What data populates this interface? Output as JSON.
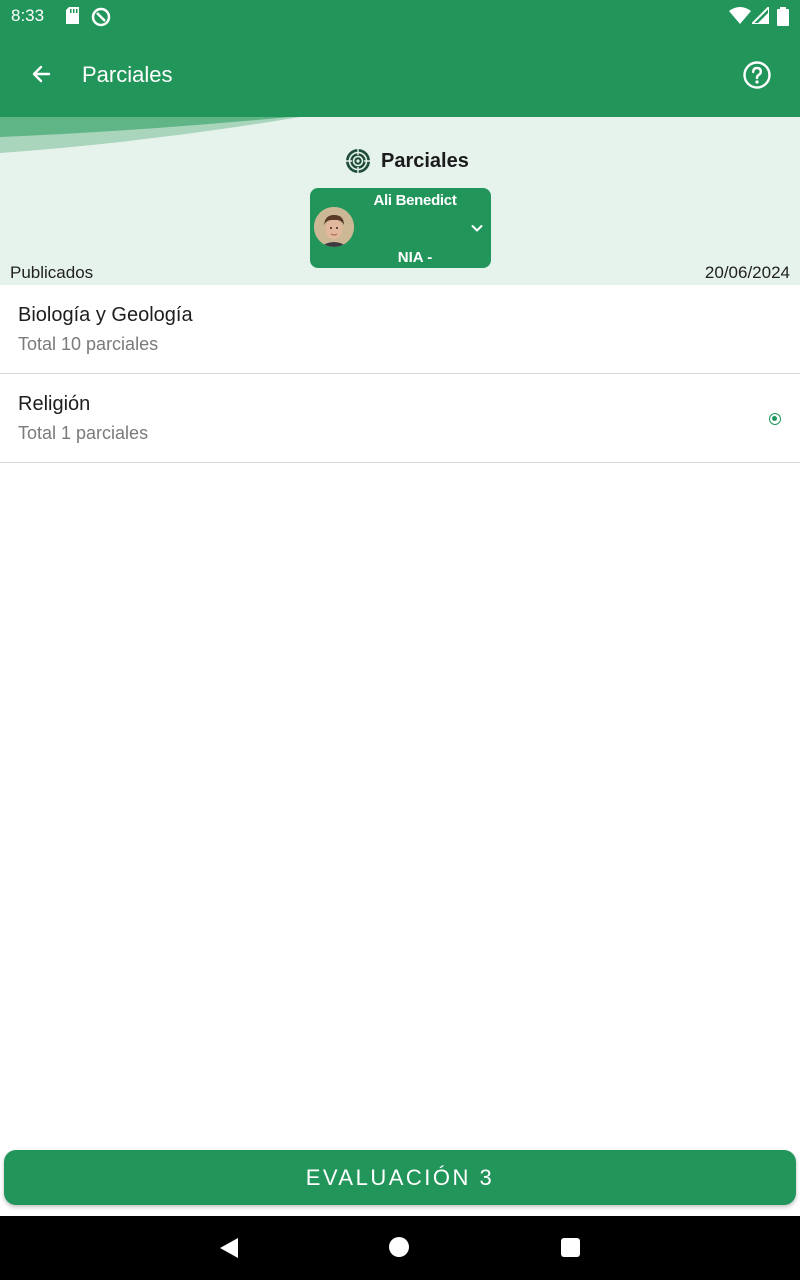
{
  "status_bar": {
    "time": "8:33"
  },
  "app_bar": {
    "title": "Parciales",
    "back_icon": "arrow-left-icon",
    "help_icon": "help-circle-icon"
  },
  "header": {
    "section_title": "Parciales",
    "section_icon": "target-icon",
    "student": {
      "name": "Ali Benedict",
      "nia": "NIA -"
    },
    "published_label": "Publicados",
    "date": "20/06/2024"
  },
  "subjects": [
    {
      "name": "Biología y Geología",
      "count": "Total 10 parciales",
      "selected": false
    },
    {
      "name": "Religión",
      "count": "Total 1 parciales",
      "selected": true
    }
  ],
  "bottom_button": {
    "label": "EVALUACIÓN 3"
  },
  "colors": {
    "primary": "#22965a",
    "header_bg": "#e6f2ec"
  }
}
